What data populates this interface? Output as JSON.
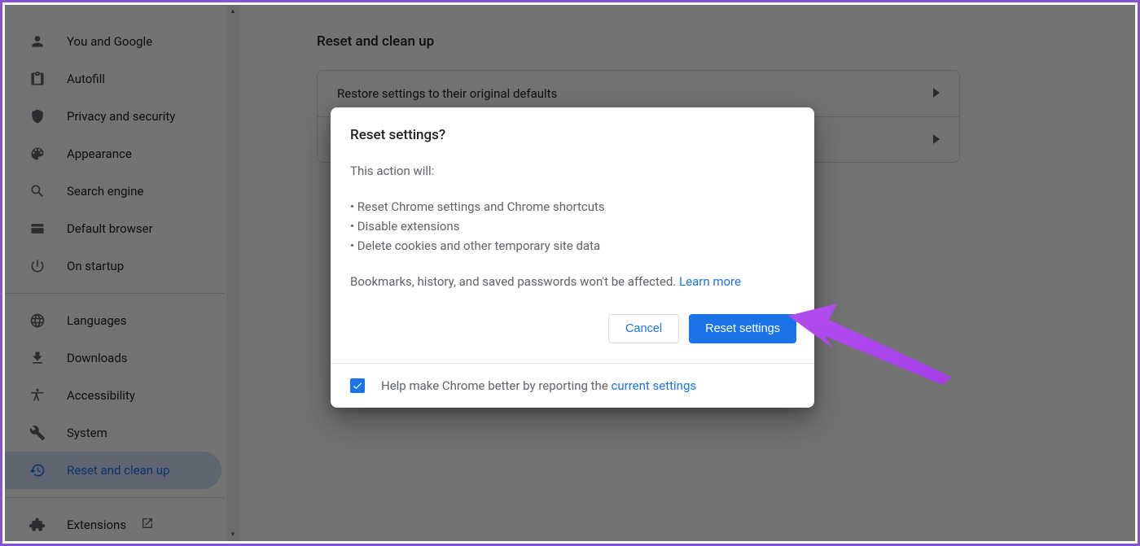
{
  "sidebar": {
    "items": [
      {
        "label": "You and Google",
        "icon": "person"
      },
      {
        "label": "Autofill",
        "icon": "clipboard"
      },
      {
        "label": "Privacy and security",
        "icon": "shield"
      },
      {
        "label": "Appearance",
        "icon": "palette"
      },
      {
        "label": "Search engine",
        "icon": "search"
      },
      {
        "label": "Default browser",
        "icon": "browser"
      },
      {
        "label": "On startup",
        "icon": "power"
      }
    ],
    "items2": [
      {
        "label": "Languages",
        "icon": "globe"
      },
      {
        "label": "Downloads",
        "icon": "download"
      },
      {
        "label": "Accessibility",
        "icon": "accessibility"
      },
      {
        "label": "System",
        "icon": "wrench"
      },
      {
        "label": "Reset and clean up",
        "icon": "restore",
        "selected": true
      }
    ],
    "extensions_label": "Extensions"
  },
  "page": {
    "heading": "Reset and clean up",
    "rows": [
      "Restore settings to their original defaults",
      ""
    ]
  },
  "dialog": {
    "title": "Reset settings?",
    "intro": "This action will:",
    "bullets": [
      "Reset Chrome settings and Chrome shortcuts",
      "Disable extensions",
      "Delete cookies and other temporary site data"
    ],
    "outro": "Bookmarks, history, and saved passwords won't be affected.",
    "learn_more": " Learn more",
    "cancel": "Cancel",
    "confirm": "Reset settings",
    "help_prefix": "Help make Chrome better by reporting the ",
    "help_link": "current settings"
  }
}
